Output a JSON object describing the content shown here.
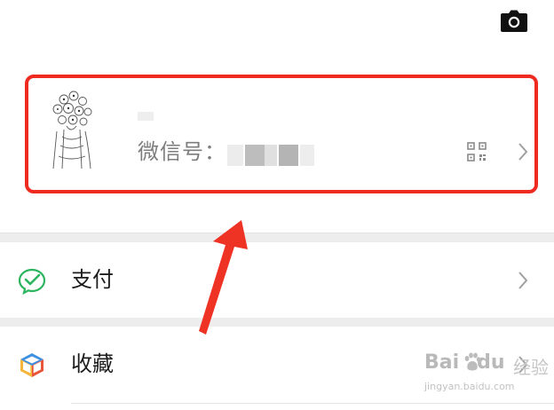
{
  "header": {
    "camera_icon": "camera-icon"
  },
  "profile": {
    "wechat_id_label": "微信号：",
    "qr_icon": "qr-code-icon",
    "chevron_icon": "chevron-right-icon"
  },
  "menu": {
    "items": [
      {
        "label": "支付",
        "icon": "wechat-pay-icon"
      },
      {
        "label": "收藏",
        "icon": "favorites-cube-icon"
      }
    ]
  },
  "annotation": {
    "highlight_color": "#ef2b21",
    "arrow_color": "#ee3325"
  },
  "watermark": {
    "brand": "Bai",
    "brand_tail": "du",
    "sub": "jingyan.baidu.com",
    "jingyan": "经验"
  }
}
